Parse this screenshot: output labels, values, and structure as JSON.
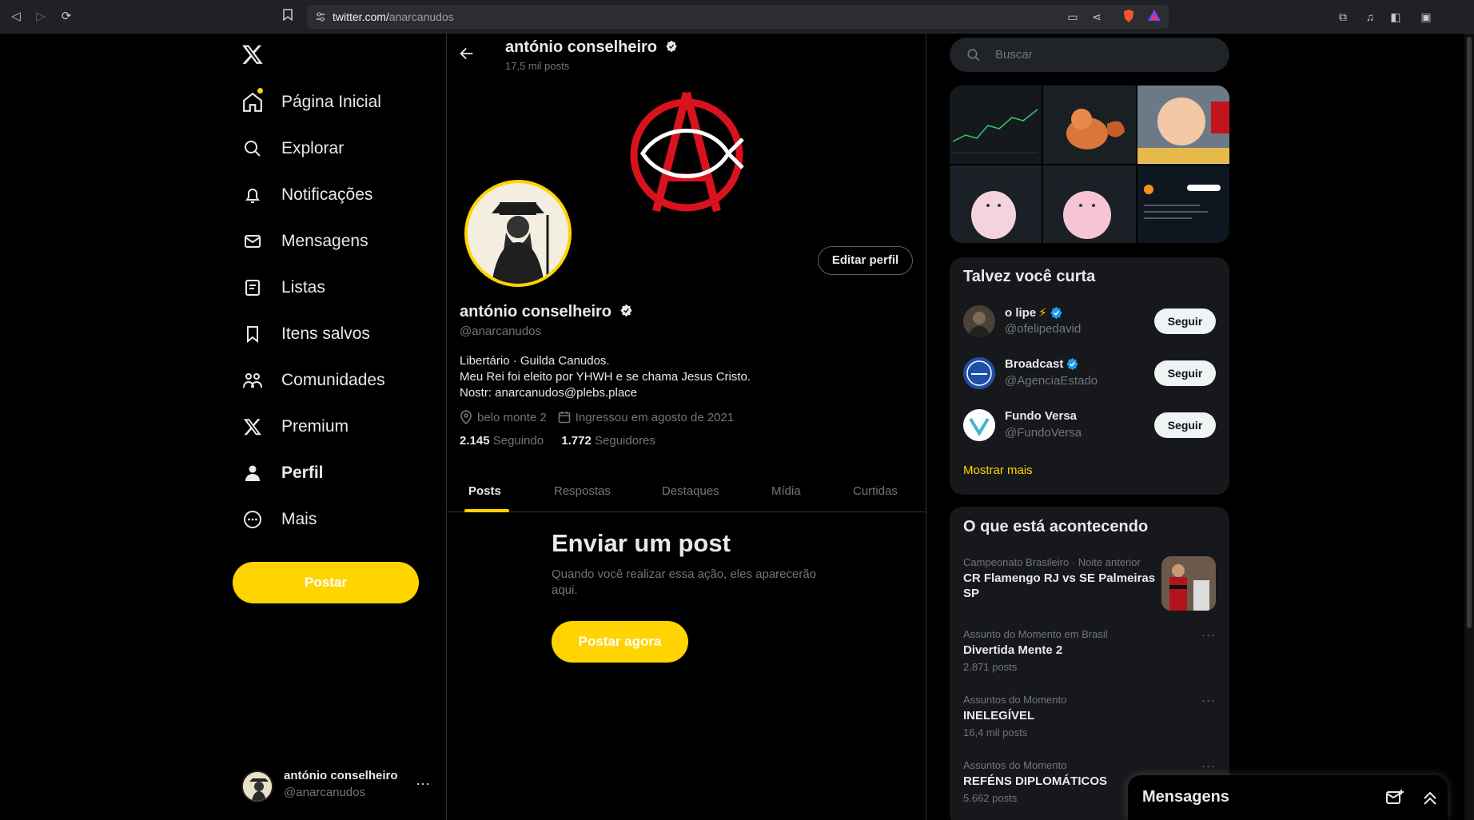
{
  "browser": {
    "url_host": "twitter.com/",
    "url_path": "anarcanudos"
  },
  "nav": {
    "items": [
      {
        "label": "Página Inicial",
        "icon": "home-icon"
      },
      {
        "label": "Explorar",
        "icon": "search-icon"
      },
      {
        "label": "Notificações",
        "icon": "bell-icon"
      },
      {
        "label": "Mensagens",
        "icon": "envelope-icon"
      },
      {
        "label": "Listas",
        "icon": "list-icon"
      },
      {
        "label": "Itens salvos",
        "icon": "bookmark-icon"
      },
      {
        "label": "Comunidades",
        "icon": "communities-icon"
      },
      {
        "label": "Premium",
        "icon": "x-icon"
      },
      {
        "label": "Perfil",
        "icon": "person-icon"
      },
      {
        "label": "Mais",
        "icon": "more-circle-icon"
      }
    ],
    "post_button": "Postar"
  },
  "account": {
    "name": "antónio conselheiro",
    "handle": "@anarcanudos"
  },
  "header": {
    "name": "antónio conselheiro",
    "post_count": "17,5 mil posts"
  },
  "profile": {
    "name": "antónio conselheiro",
    "handle": "@anarcanudos",
    "edit_button": "Editar perfil",
    "bio_line1": "Libertário · Guilda Canudos.",
    "bio_line2": "Meu Rei foi eleito por YHWH e se chama Jesus Cristo.",
    "bio_line3": "Nostr: anarcanudos@plebs.place",
    "location": "belo monte 2",
    "joined": "Ingressou em agosto de 2021",
    "following_count": "2.145",
    "following_label": "Seguindo",
    "followers_count": "1.772",
    "followers_label": "Seguidores"
  },
  "tabs": [
    "Posts",
    "Respostas",
    "Destaques",
    "Mídia",
    "Curtidas"
  ],
  "empty": {
    "title": "Enviar um post",
    "desc": "Quando você realizar essa ação, eles aparecerão aqui.",
    "button": "Postar agora"
  },
  "search": {
    "placeholder": "Buscar"
  },
  "suggestions": {
    "title": "Talvez você curta",
    "follow_label": "Seguir",
    "show_more": "Mostrar mais",
    "items": [
      {
        "name": "o lipe",
        "handle": "@ofelipedavid",
        "verified": true
      },
      {
        "name": "Broadcast",
        "handle": "@AgenciaEstado",
        "verified": true
      },
      {
        "name": "Fundo Versa",
        "handle": "@FundoVersa",
        "verified": false
      }
    ]
  },
  "trends": {
    "title": "O que está acontecendo",
    "items": [
      {
        "context": "Campeonato Brasileiro · Noite anterior",
        "title": "CR Flamengo RJ vs SE Palmeiras SP",
        "count": ""
      },
      {
        "context": "Assunto do Momento em Brasil",
        "title": "Divertida Mente 2",
        "count": "2.871 posts"
      },
      {
        "context": "Assuntos do Momento",
        "title": "INELEGÍVEL",
        "count": "16,4 mil posts"
      },
      {
        "context": "Assuntos do Momento",
        "title": "REFÉNS DIPLOMÁTICOS",
        "count": "5.662 posts"
      }
    ]
  },
  "messages_drawer": {
    "title": "Mensagens"
  },
  "colors": {
    "accent": "#ffd400",
    "background": "#000000",
    "card": "#16181c",
    "muted": "#71767b",
    "verified": "#1d9bf0"
  }
}
